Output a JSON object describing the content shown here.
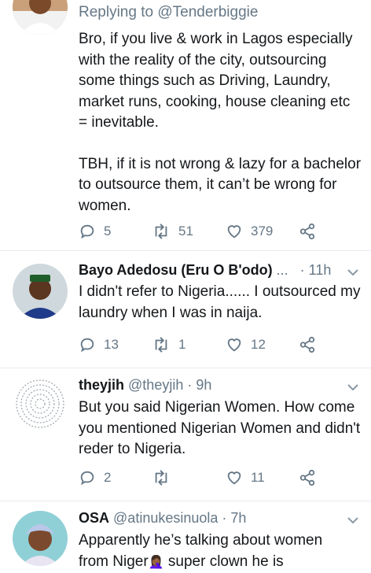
{
  "tweet1": {
    "reply_prefix": "Replying to ",
    "reply_handle": "@Tenderbiggie",
    "para1": "Bro, if you live & work in Lagos especially with the reality of the city, outsourcing some things such as Driving, Laundry, market runs, cooking, house cleaning etc = inevitable.",
    "para2": "TBH, if it is not wrong & lazy for a bachelor to outsource them, it can’t be wrong for women.",
    "replies": "5",
    "retweets": "51",
    "likes": "379"
  },
  "tweet2": {
    "name": "Bayo Adedosu (Eru O B'odo)",
    "ellipsis": "...",
    "time": "· 11h",
    "text": "I didn't refer to Nigeria...... I outsourced my laundry when I was in naija.",
    "replies": "13",
    "retweets": "1",
    "likes": "12"
  },
  "tweet3": {
    "name": "theyjih",
    "handle": "@theyjih",
    "time": "· 9h",
    "text": "But you said Nigerian Women. How come you mentioned Nigerian Women and didn't reder to Nigeria.",
    "replies": "2",
    "retweets": "",
    "likes": "11"
  },
  "tweet4": {
    "name": "OSA",
    "handle": "@atinukesinuola",
    "time": "· 7h",
    "line1": "Apparently he’s talking about women",
    "line2a": "from Niger",
    "emoji": "🤦🏾‍♀️",
    "line2b": " super clown he is"
  },
  "colors": {
    "text": "#14171a",
    "muted": "#657786",
    "divider": "#e6ecf0"
  },
  "icons": [
    "reply-icon",
    "retweet-icon",
    "like-icon",
    "share-icon",
    "chevron-down-icon"
  ]
}
